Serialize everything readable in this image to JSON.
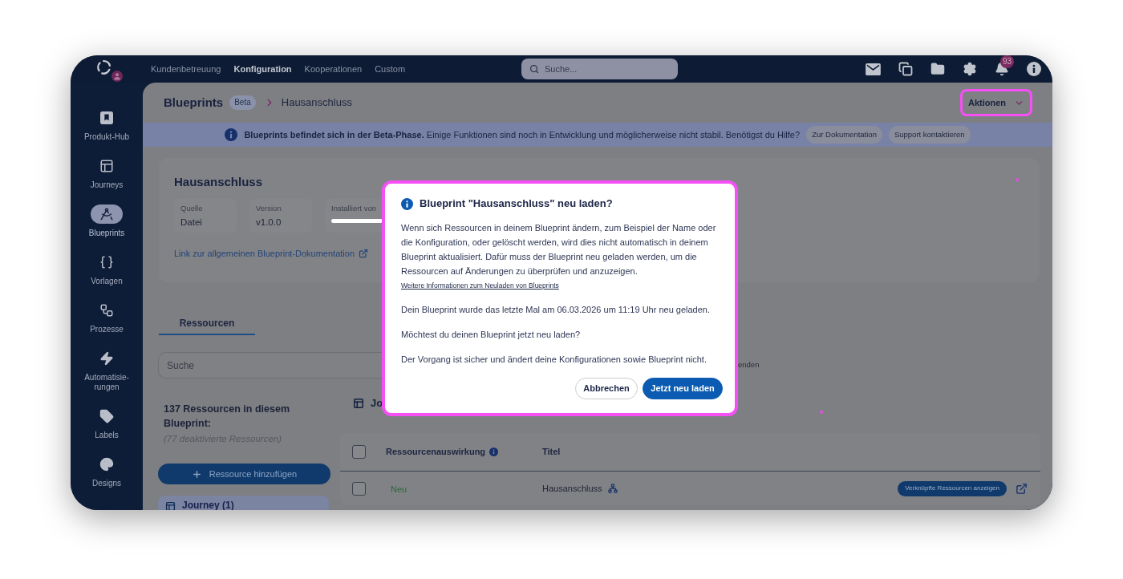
{
  "top_nav": {
    "items": [
      {
        "label": "Kundenbetreuung",
        "selected": false
      },
      {
        "label": "Konfiguration",
        "selected": true
      },
      {
        "label": "Kooperationen",
        "selected": false
      },
      {
        "label": "Custom",
        "selected": false
      }
    ],
    "search": {
      "placeholder": "Suche..."
    },
    "notification_count": "93"
  },
  "sidebar": {
    "items": [
      {
        "label": "Produkt-Hub",
        "selected": false
      },
      {
        "label": "Journeys",
        "selected": false
      },
      {
        "label": "Blueprints",
        "selected": true
      },
      {
        "label": "Vorlagen",
        "selected": false
      },
      {
        "label": "Prozesse",
        "selected": false
      },
      {
        "label": "Automatisie-rungen",
        "selected": false
      },
      {
        "label": "Labels",
        "selected": false
      },
      {
        "label": "Designs",
        "selected": false
      }
    ]
  },
  "header": {
    "title": "Blueprints",
    "badge": "Beta",
    "current": "Hausanschluss",
    "actions_button": {
      "label": "Aktionen",
      "highlighted": true
    }
  },
  "banner": {
    "text": "**Blueprints befindet sich in der Beta-Phase.** Einige Funktionen sind noch in Entwicklung und möglicherweise nicht stabil. Benötigst du Hilfe?",
    "buttons": [
      "Zur Dokumentation",
      "Support kontaktieren"
    ]
  },
  "blueprint_card": {
    "title": "Hausanschluss",
    "fields": [
      {
        "label": "Quelle",
        "value": "Datei",
        "redacted": false
      },
      {
        "label": "Version",
        "value": "v1.0.0",
        "redacted": false
      },
      {
        "label": "Installiert von",
        "redacted": true
      }
    ],
    "link": "Link zur allgemeinen Blueprint-Dokumentation"
  },
  "tabs": [
    {
      "label": "Ressourcen",
      "selected": true
    }
  ],
  "resource_search": {
    "placeholder": "Suche",
    "option_fragment": "enden"
  },
  "summary": {
    "count": "137 Ressourcen in diesem Blueprint:",
    "deactivated": "(77 deaktivierte Ressourcen)"
  },
  "add_button": "Ressource hinzufügen",
  "resource_groups": [
    {
      "label": "Journey (1)",
      "selected": true
    }
  ],
  "group_heading": "Jo",
  "table": {
    "select_all_checked": false,
    "columns": [
      "Ressourcenauswirkung",
      "Titel"
    ],
    "rows": [
      {
        "checked": false,
        "impact": "Neu",
        "title": "Hausanschluss",
        "action": "Verknüpfte Ressourcen anzeigen"
      }
    ]
  },
  "dialog": {
    "highlighted": true,
    "title": "Blueprint \"Hausanschluss\" neu laden?",
    "body": "Wenn sich Ressourcen in deinem Blueprint ändern, zum Beispiel der Name oder die Konfiguration, oder gelöscht werden, wird dies nicht automatisch in deinem Blueprint aktualisiert. Dafür muss der Blueprint neu geladen werden, um die Ressourcen auf Änderungen zu überprüfen und anzuzeigen.",
    "link": "Weitere Informationen zum Neuladen von Blueprints",
    "last_reload": "Dein Blueprint wurde das letzte Mal am 06.03.2026 um 11:19 Uhr neu geladen.",
    "question": "Möchtest du deinen Blueprint jetzt neu laden?",
    "note": "Der Vorgang ist sicher und ändert deine Konfigurationen sowie Blueprint nicht.",
    "buttons": [
      {
        "label": "Abbrechen",
        "kind": "secondary"
      },
      {
        "label": "Jetzt neu laden",
        "kind": "primary"
      }
    ]
  }
}
